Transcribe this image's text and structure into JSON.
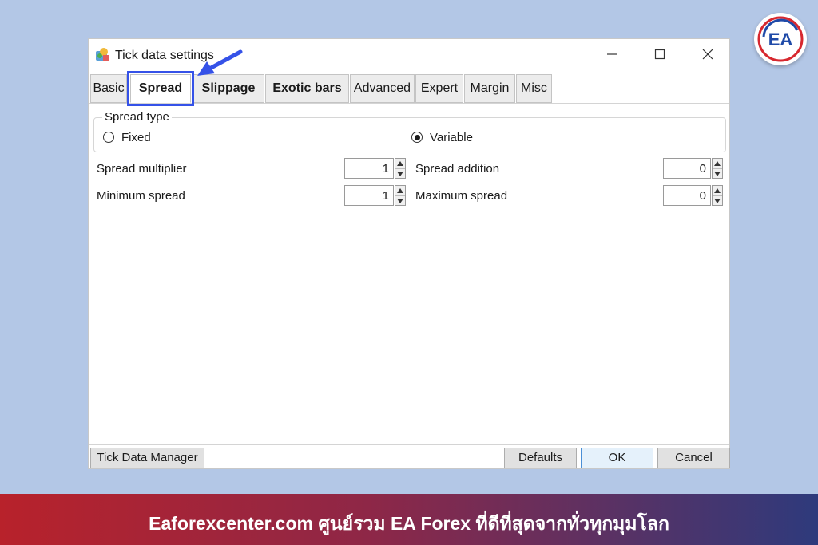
{
  "logo": {
    "text": "EA",
    "colors": {
      "red": "#d7282f",
      "blue": "#1f4aa8"
    }
  },
  "window": {
    "title": "Tick data settings",
    "icon": "app-settings-icon",
    "controls": [
      "minimize-icon",
      "maximize-icon",
      "close-icon"
    ]
  },
  "tabs": [
    {
      "label": "Basic"
    },
    {
      "label": "Spread",
      "active": true
    },
    {
      "label": "Slippage"
    },
    {
      "label": "Exotic bars"
    },
    {
      "label": "Advanced"
    },
    {
      "label": "Expert"
    },
    {
      "label": "Margin"
    },
    {
      "label": "Misc"
    }
  ],
  "spread_type": {
    "group_label": "Spread type",
    "options": [
      {
        "label": "Fixed",
        "selected": false
      },
      {
        "label": "Variable",
        "selected": true
      }
    ]
  },
  "fields": {
    "spread_multiplier": {
      "label": "Spread multiplier",
      "value": "1"
    },
    "spread_addition": {
      "label": "Spread addition",
      "value": "0"
    },
    "minimum_spread": {
      "label": "Minimum spread",
      "value": "1"
    },
    "maximum_spread": {
      "label": "Maximum spread",
      "value": "0"
    }
  },
  "buttons": {
    "tick_data_manager": "Tick Data Manager",
    "defaults": "Defaults",
    "ok": "OK",
    "cancel": "Cancel"
  },
  "annotation": {
    "highlight_color": "#3552e8"
  },
  "banner": {
    "text": "Eaforexcenter.com ศูนย์รวม EA Forex ที่ดีที่สุดจากทั่วทุกมุมโลก"
  }
}
